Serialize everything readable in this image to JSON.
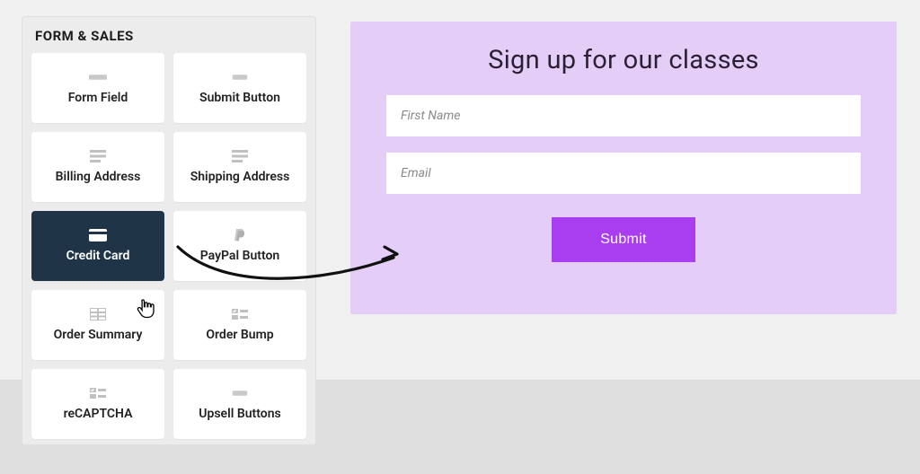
{
  "panel": {
    "title": "FORM & SALES",
    "tiles": [
      {
        "label": "Form Field",
        "icon": "input-icon"
      },
      {
        "label": "Submit Button",
        "icon": "button-icon"
      },
      {
        "label": "Billing Address",
        "icon": "lines-icon"
      },
      {
        "label": "Shipping Address",
        "icon": "lines-icon"
      },
      {
        "label": "Credit Card",
        "icon": "card-icon",
        "selected": true
      },
      {
        "label": "PayPal Button",
        "icon": "paypal-icon"
      },
      {
        "label": "Order Summary",
        "icon": "table-icon"
      },
      {
        "label": "Order Bump",
        "icon": "checklist-icon"
      },
      {
        "label": "reCAPTCHA",
        "icon": "checklist-icon"
      },
      {
        "label": "Upsell Buttons",
        "icon": "button-icon"
      }
    ]
  },
  "form": {
    "title": "Sign up for our classes",
    "first_name_placeholder": "First Name",
    "email_placeholder": "Email",
    "submit_label": "Submit"
  },
  "colors": {
    "tile_selected_bg": "#1f3447",
    "form_bg": "#e4cef8",
    "submit_bg": "#a83ef0"
  }
}
